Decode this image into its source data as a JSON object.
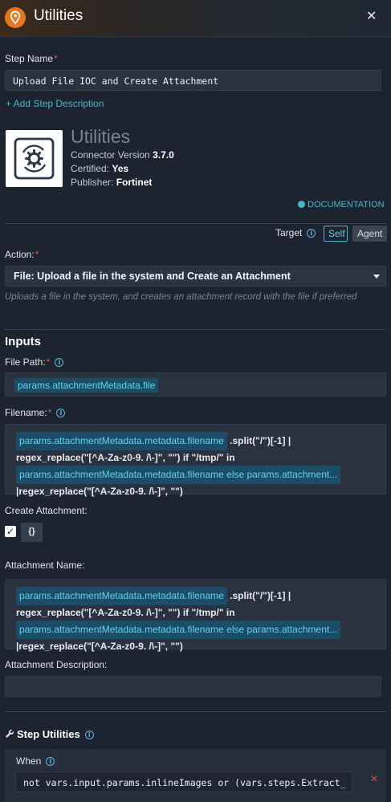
{
  "header": {
    "title": "Utilities",
    "icon": "utilities-app-icon",
    "accent": "#e8761b"
  },
  "step": {
    "name_label": "Step Name",
    "name_value": "Upload File IOC and Create Attachment",
    "add_description": "+ Add Step Description"
  },
  "connector": {
    "name": "Utilities",
    "version_label": "Connector Version",
    "version": "3.7.0",
    "certified_label": "Certified:",
    "certified": "Yes",
    "publisher_label": "Publisher:",
    "publisher": "Fortinet",
    "documentation": "DOCUMENTATION"
  },
  "target": {
    "label": "Target",
    "options": [
      "Self",
      "Agent"
    ],
    "selected": "Self"
  },
  "action": {
    "label": "Action:",
    "selected": "File: Upload a file in the system and Create an Attachment",
    "description": "Uploads a file in the system, and creates an attachment record with the file if preferred"
  },
  "inputs": {
    "title": "Inputs",
    "file_path": {
      "label": "File Path:",
      "value": "params.attachmentMetadata.file"
    },
    "filename": {
      "label": "Filename:",
      "tag1": "params.attachmentMetadata.metadata.filename",
      "text1": ".split(\"/\")[-1] |",
      "text2": "regex_replace(\"[^A-Za-z0-9. /\\-]\", \"\") if \"/tmp/\" in",
      "tag2": "params.attachmentMetadata.metadata.filename else params.attachment...",
      "text3": "|regex_replace(\"[^A-Za-z0-9. /\\-]\", \"\")"
    },
    "create_attachment": {
      "label": "Create Attachment:",
      "checked": true,
      "toggle": "{}"
    },
    "attachment_name": {
      "label": "Attachment Name:",
      "tag1": "params.attachmentMetadata.metadata.filename",
      "text1": ".split(\"/\")[-1] |",
      "text2": "regex_replace(\"[^A-Za-z0-9. /\\-]\", \"\") if \"/tmp/\" in",
      "tag2": "params.attachmentMetadata.metadata.filename else params.attachment...",
      "text3": "|regex_replace(\"[^A-Za-z0-9. /\\-]\", \"\")"
    },
    "attachment_description": {
      "label": "Attachment Description:",
      "value": ""
    }
  },
  "step_utilities": {
    "title": "Step Utilities",
    "when_label": "When",
    "when_value": "not vars.input.params.inlineImages or (vars.steps.Extract_QR_C"
  }
}
